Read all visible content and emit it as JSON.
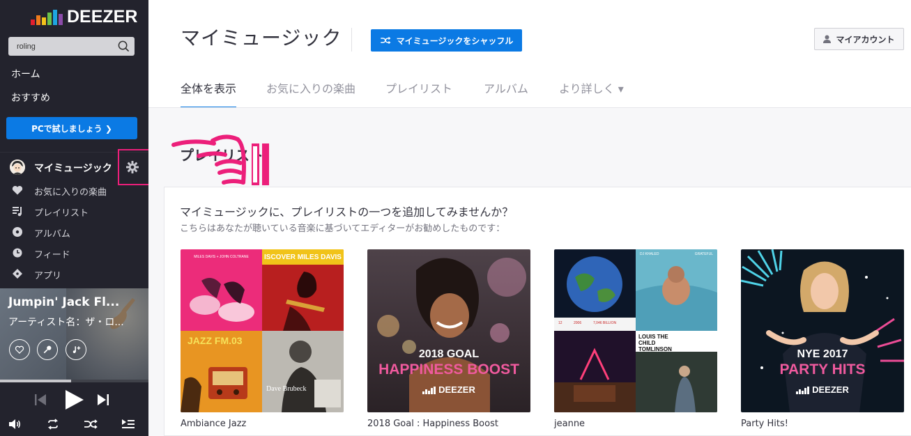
{
  "brand": {
    "logo_text": "DEEZER",
    "bar_colors": [
      "#e41f2e",
      "#f07b1c",
      "#f4c21b",
      "#6bc24b",
      "#1ea5e0",
      "#8b4ba9"
    ]
  },
  "sidebar": {
    "search": {
      "value": "roling",
      "icon": "search-icon"
    },
    "nav": [
      {
        "label": "ホーム"
      },
      {
        "label": "おすすめ"
      }
    ],
    "try_button": "PCで試しましょう ❯",
    "my_music": {
      "label": "マイミュージック",
      "icon": "gear-icon"
    },
    "items": [
      {
        "label": "お気に入りの楽曲",
        "icon": "heart-icon"
      },
      {
        "label": "プレイリスト",
        "icon": "playlist-icon"
      },
      {
        "label": "アルバム",
        "icon": "album-icon"
      },
      {
        "label": "フィード",
        "icon": "clock-icon"
      },
      {
        "label": "アプリ",
        "icon": "diamond-icon"
      }
    ]
  },
  "player": {
    "track_title": "Jumpin' Jack Fl...",
    "artist_line": "アーティスト名：ザ・ロ...",
    "progress": 0.48,
    "buttons": [
      "heart-icon",
      "microphone-icon",
      "add-to-playlist-icon"
    ],
    "controls": [
      "previous-icon",
      "play-icon",
      "next-icon",
      "volume-icon",
      "repeat-icon",
      "shuffle-icon",
      "queue-icon"
    ]
  },
  "header": {
    "title": "マイミュージック",
    "shuffle_button": "マイミュージックをシャッフル",
    "account_button": "マイアカウント"
  },
  "tabs": [
    {
      "label": "全体を表示",
      "active": true
    },
    {
      "label": "お気に入りの楽曲",
      "active": false
    },
    {
      "label": "プレイリスト",
      "active": false
    },
    {
      "label": "アルバム",
      "active": false
    },
    {
      "label": "より詳しく ▾",
      "active": false
    }
  ],
  "section": {
    "title": "プレイリスト",
    "promo_title": "マイミュージックに、プレイリストの一つを追加してみませんか？",
    "promo_subtitle": "こちらはあなたが聴いている音楽に基づいてエディターがお勧めしたものです："
  },
  "playlists": [
    {
      "name": "Ambiance Jazz",
      "cover_texts": [
        "MILES DAVIS + JOHN COLTRANE",
        "ISCOVER MILES DAVIS",
        "JAZZ FM.03",
        "Dave Brubeck"
      ]
    },
    {
      "name": "2018 Goal : Happiness Boost",
      "cover_line1": "2018 GOAL",
      "cover_line2": "HAPPINESS BOOST",
      "cover_brand": "DEEZER"
    },
    {
      "name": "jeanne",
      "cover_texts": [
        "DJ KHALED",
        "GRATEFUL",
        "12",
        "2006",
        "7,046 BILLION",
        "LOUIS THE CHILD TOMLINSON"
      ]
    },
    {
      "name": "Party Hits!",
      "cover_line1": "NYE 2017",
      "cover_line2": "PARTY HITS",
      "cover_brand": "DEEZER"
    }
  ],
  "colors": {
    "accent_blue": "#0b7ae4",
    "annotation_pink": "#ec1f7a",
    "sidebar_bg": "#23232d",
    "cover_pink": "#f05a9e"
  }
}
